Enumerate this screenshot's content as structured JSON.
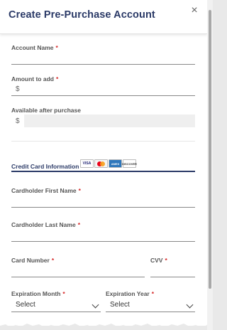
{
  "modal": {
    "title": "Create Pre-Purchase Account",
    "close_symbol": "×"
  },
  "account": {
    "name_label": "Account Name",
    "amount_label": "Amount to add",
    "available_label": "Available after purchase",
    "currency_symbol": "$",
    "required_marker": "*"
  },
  "credit_card": {
    "section_title": "Credit Card Information",
    "logos": {
      "visa": "VISA",
      "amex": "AMEX",
      "discover": "DISCOVER"
    },
    "first_name_label": "Cardholder First Name",
    "last_name_label": "Cardholder Last Name",
    "number_label": "Card Number",
    "cvv_label": "CVV",
    "exp_month_label": "Expiration Month",
    "exp_year_label": "Expiration Year",
    "exp_month_value": "Select",
    "exp_year_value": "Select"
  },
  "colors": {
    "title": "#2b3a67",
    "required": "#d62828",
    "disabled_bg": "#efefef"
  }
}
